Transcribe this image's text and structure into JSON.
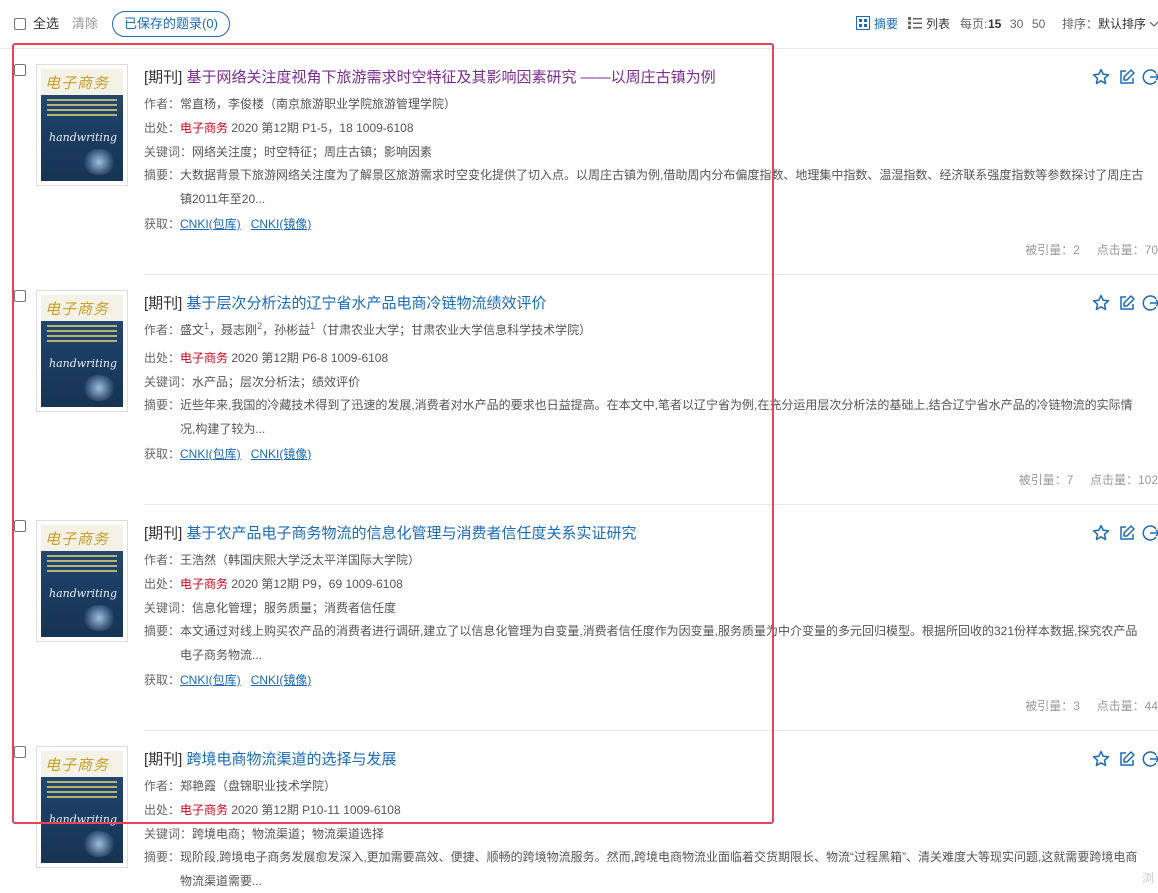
{
  "toolbar": {
    "select_all": "全选",
    "clear": "清除",
    "saved": "已保存的题录(0)",
    "view_abstract": "摘要",
    "view_list": "列表",
    "per_page_label": "每页:",
    "per_page_options": [
      "15",
      "30",
      "50"
    ],
    "sort_label": "排序：",
    "sort_value": "默认排序"
  },
  "labels": {
    "author": "作者：",
    "source": "出处：",
    "keywords": "关键词：",
    "abstract": "摘要：",
    "access": "获取：",
    "cited": "被引量：",
    "clicks": "点击量："
  },
  "cover": {
    "logo": "电子商务",
    "hand": "handwriting"
  },
  "records": [
    {
      "type": "[期刊]",
      "title": "基于网络关注度视角下旅游需求时空特征及其影响因素研究 ——以周庄古镇为例",
      "authors": "常直杨，李俊楼（南京旅游职业学院旅游管理学院）",
      "source": "电子商务",
      "issue": "2020 第12期 P1-5，18  1009-6108",
      "keywords": "网络关注度；时空特征；周庄古镇；影响因素",
      "abstract": "大数据背景下旅游网络关注度为了解景区旅游需求时空变化提供了切入点。以周庄古镇为例,借助周内分布偏度指数、地理集中指数、温湿指数、经济联系强度指数等参数探讨了周庄古镇2011年至20...",
      "link1": "CNKI(包库)",
      "link2": "CNKI(镜像)",
      "cited": "2",
      "clicks": "70"
    },
    {
      "type": "[期刊]",
      "title": "基于层次分析法的辽宁省水产品电商冷链物流绩效评价",
      "author1": "盛文",
      "sup1": "1",
      "author2": "，聂志刚",
      "sup2": "2",
      "author3": "，孙彬益",
      "sup3": "1",
      "affil": "（甘肃农业大学；甘肃农业大学信息科学技术学院）",
      "source": "电子商务",
      "issue": "2020 第12期 P6-8  1009-6108",
      "keywords": "水产品；层次分析法；绩效评价",
      "abstract": "近些年来,我国的冷藏技术得到了迅速的发展,消费者对水产品的要求也日益提高。在本文中,笔者以辽宁省为例,在充分运用层次分析法的基础上,结合辽宁省水产品的冷链物流的实际情况,构建了较为...",
      "link1": "CNKI(包库)",
      "link2": "CNKI(镜像)",
      "cited": "7",
      "clicks": "102"
    },
    {
      "type": "[期刊]",
      "title": "基于农产品电子商务物流的信息化管理与消费者信任度关系实证研究",
      "authors": "王浩然（韩国庆熙大学泛太平洋国际大学院）",
      "source": "电子商务",
      "issue": "2020 第12期 P9，69  1009-6108",
      "keywords": "信息化管理；服务质量；消费者信任度",
      "abstract": "本文通过对线上购买农产品的消费者进行调研,建立了以信息化管理为自变量,消费者信任度作为因变量,服务质量为中介变量的多元回归模型。根据所回收的321份样本数据,探究农产品电子商务物流...",
      "link1": "CNKI(包库)",
      "link2": "CNKI(镜像)",
      "cited": "3",
      "clicks": "44"
    },
    {
      "type": "[期刊]",
      "title": "跨境电商物流渠道的选择与发展",
      "authors": "郑艳霞（盘锦职业技术学院）",
      "source": "电子商务",
      "issue": "2020 第12期 P10-11  1009-6108",
      "keywords": "跨境电商；物流渠道；物流渠道选择",
      "abstract": "现阶段,跨境电子商务发展愈发深入,更加需要高效、便捷、顺畅的跨境物流服务。然而,跨境电商物流业面临着交货期限长、物流“过程黑箱”、清关难度大等现实问题,这就需要跨境电商物流渠道需要..."
    }
  ],
  "corner_text": "浏"
}
